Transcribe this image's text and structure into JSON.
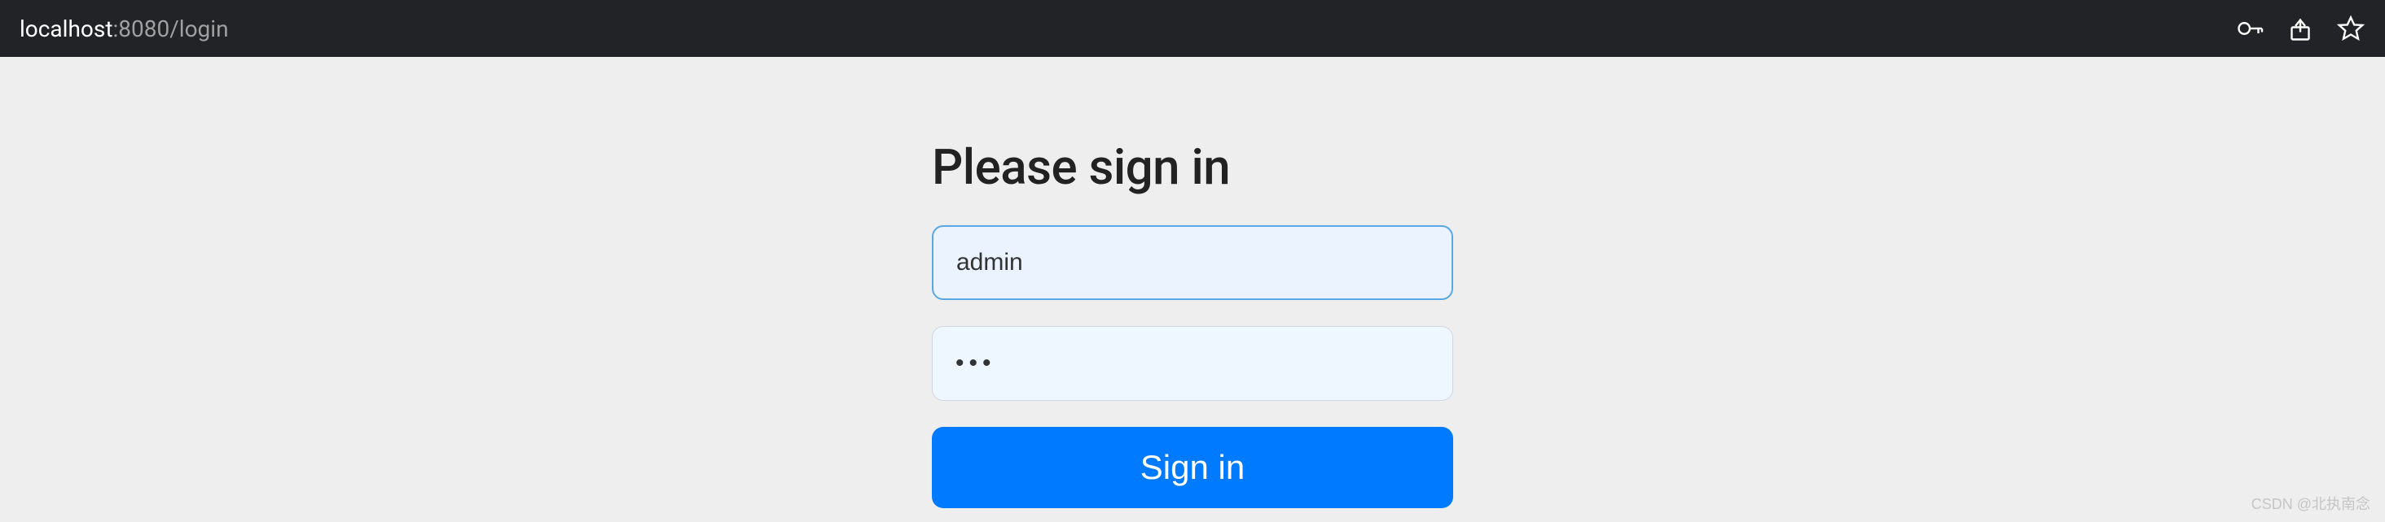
{
  "browser": {
    "url_host": "localhost",
    "url_rest": ":8080/login"
  },
  "form": {
    "title": "Please sign in",
    "username_value": "admin",
    "password_value": "•••",
    "submit_label": "Sign in"
  },
  "watermark": "CSDN @北执南念"
}
